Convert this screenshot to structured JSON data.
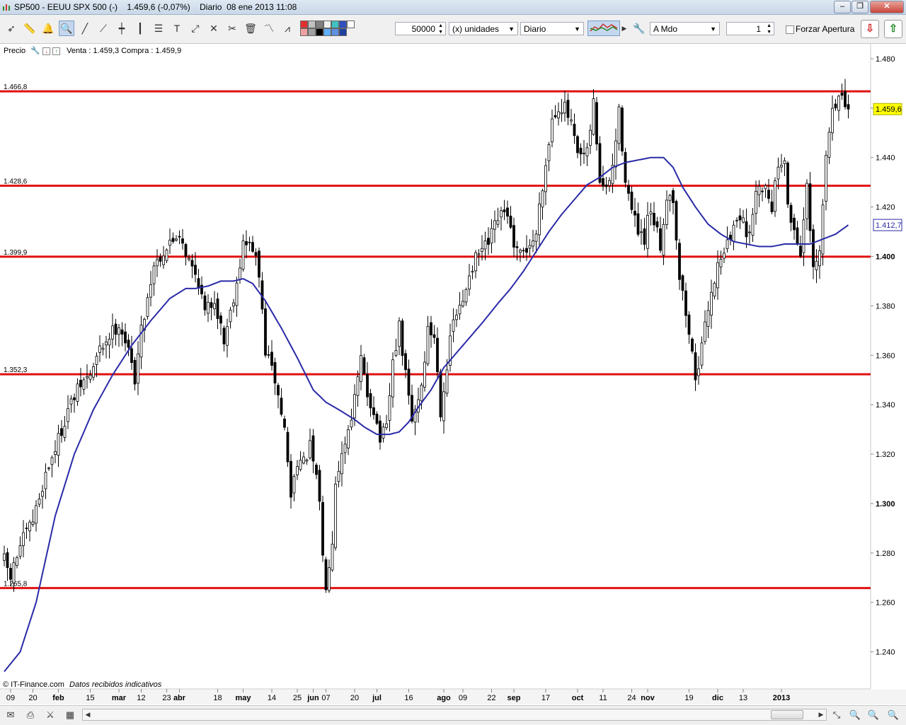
{
  "window": {
    "title": "SP500 - EEUU SPX 500 (-)    1.459,6 (-0,07%)    Diario  08 ene 2013 11:08",
    "minimize": "‒",
    "restore": "❐",
    "close": "✕"
  },
  "toolbar": {
    "quantity": "50000",
    "units": "(x) unidades",
    "period": "Diario",
    "order_type": "A Mdo",
    "lots": "1",
    "force_open": "Forzar Apertura",
    "swatch_colors": [
      "#e03030",
      "#f0a0a0",
      "#c0c0c0",
      "#a0a0a0",
      "#808080",
      "#000000",
      "#f0f0f0",
      "#60b0ff",
      "#40c0c0",
      "#6090e0",
      "#3050c0",
      "#2040a0",
      "#ffffff"
    ]
  },
  "price_panel": {
    "label": "Precio",
    "quote": "Venta : 1.459,3  Compra : 1.459,9"
  },
  "footer": {
    "source": "© IT-Finance.com",
    "note": "Datos recibidos indicativos"
  },
  "chart_data": {
    "type": "candlestick",
    "instrument": "SP500 - EEUU SPX 500",
    "period": "Diario",
    "ylim": [
      1225,
      1486
    ],
    "y_ticks": [
      1240,
      1260,
      1280,
      1300,
      1320,
      1340,
      1360,
      1380,
      1400,
      1420,
      1440,
      1460,
      1480
    ],
    "y_tick_labels": [
      "1.240",
      "1.260",
      "1.280",
      "1.300",
      "1.320",
      "1.340",
      "1.360",
      "1.380",
      "1.400",
      "1.420",
      "1.440",
      "1.460",
      "1.480"
    ],
    "y_bold_labels": [
      "1.300",
      "1.400"
    ],
    "last_price_label": "1.459,6",
    "last_price": 1459.6,
    "ma_label": "1.412,7",
    "ma_value": 1412.7,
    "x_labels": [
      {
        "t": "09",
        "i": 2
      },
      {
        "t": "20",
        "i": 9
      },
      {
        "t": "feb",
        "i": 17,
        "bold": true
      },
      {
        "t": "15",
        "i": 27
      },
      {
        "t": "mar",
        "i": 36,
        "bold": true
      },
      {
        "t": "12",
        "i": 43
      },
      {
        "t": "23",
        "i": 51
      },
      {
        "t": "abr",
        "i": 55,
        "bold": true
      },
      {
        "t": "18",
        "i": 67
      },
      {
        "t": "may",
        "i": 75,
        "bold": true
      },
      {
        "t": "14",
        "i": 84
      },
      {
        "t": "25",
        "i": 92
      },
      {
        "t": "jun",
        "i": 97,
        "bold": true
      },
      {
        "t": "07",
        "i": 101
      },
      {
        "t": "20",
        "i": 110
      },
      {
        "t": "jul",
        "i": 117,
        "bold": true
      },
      {
        "t": "16",
        "i": 127
      },
      {
        "t": "ago",
        "i": 138,
        "bold": true
      },
      {
        "t": "09",
        "i": 144
      },
      {
        "t": "22",
        "i": 153
      },
      {
        "t": "sep",
        "i": 160,
        "bold": true
      },
      {
        "t": "17",
        "i": 170
      },
      {
        "t": "oct",
        "i": 180,
        "bold": true
      },
      {
        "t": "11",
        "i": 188
      },
      {
        "t": "24",
        "i": 197
      },
      {
        "t": "nov",
        "i": 202,
        "bold": true
      },
      {
        "t": "19",
        "i": 215
      },
      {
        "t": "dic",
        "i": 224,
        "bold": true
      },
      {
        "t": "13",
        "i": 232
      },
      {
        "t": "2013",
        "i": 244,
        "bold": true
      }
    ],
    "n_bars": 251,
    "support_resistance": [
      {
        "label": "1.466,8",
        "value": 1466.8
      },
      {
        "label": "1.428,6",
        "value": 1428.6
      },
      {
        "label": "1.399,9",
        "value": 1399.9
      },
      {
        "label": "1.352,3",
        "value": 1352.3
      },
      {
        "label": "1.265,8",
        "value": 1265.8
      }
    ],
    "close_anchors": [
      [
        0,
        1277
      ],
      [
        2,
        1270
      ],
      [
        5,
        1283
      ],
      [
        9,
        1293
      ],
      [
        13,
        1312
      ],
      [
        17,
        1326
      ],
      [
        20,
        1338
      ],
      [
        24,
        1348
      ],
      [
        27,
        1352
      ],
      [
        30,
        1362
      ],
      [
        33,
        1368
      ],
      [
        36,
        1373
      ],
      [
        38,
        1366
      ],
      [
        41,
        1351
      ],
      [
        43,
        1370
      ],
      [
        47,
        1397
      ],
      [
        52,
        1405
      ],
      [
        55,
        1410
      ],
      [
        58,
        1398
      ],
      [
        61,
        1390
      ],
      [
        63,
        1377
      ],
      [
        66,
        1383
      ],
      [
        69,
        1366
      ],
      [
        73,
        1390
      ],
      [
        75,
        1405
      ],
      [
        78,
        1404
      ],
      [
        80,
        1392
      ],
      [
        82,
        1362
      ],
      [
        85,
        1350
      ],
      [
        88,
        1330
      ],
      [
        90,
        1303
      ],
      [
        92,
        1318
      ],
      [
        94,
        1316
      ],
      [
        96,
        1323
      ],
      [
        99,
        1302
      ],
      [
        100,
        1278
      ],
      [
        101,
        1268
      ],
      [
        103,
        1286
      ],
      [
        104,
        1310
      ],
      [
        107,
        1325
      ],
      [
        110,
        1342
      ],
      [
        112,
        1358
      ],
      [
        114,
        1344
      ],
      [
        116,
        1338
      ],
      [
        118,
        1326
      ],
      [
        120,
        1330
      ],
      [
        122,
        1357
      ],
      [
        124,
        1371
      ],
      [
        126,
        1352
      ],
      [
        128,
        1333
      ],
      [
        131,
        1348
      ],
      [
        133,
        1370
      ],
      [
        135,
        1368
      ],
      [
        137,
        1338
      ],
      [
        139,
        1356
      ],
      [
        141,
        1374
      ],
      [
        144,
        1381
      ],
      [
        146,
        1394
      ],
      [
        149,
        1401
      ],
      [
        152,
        1405
      ],
      [
        155,
        1415
      ],
      [
        158,
        1418
      ],
      [
        160,
        1402
      ],
      [
        162,
        1400
      ],
      [
        165,
        1405
      ],
      [
        167,
        1408
      ],
      [
        168,
        1422
      ],
      [
        170,
        1437
      ],
      [
        172,
        1456
      ],
      [
        174,
        1461
      ],
      [
        176,
        1460
      ],
      [
        178,
        1453
      ],
      [
        180,
        1440
      ],
      [
        183,
        1441
      ],
      [
        185,
        1462
      ],
      [
        187,
        1431
      ],
      [
        189,
        1426
      ],
      [
        191,
        1436
      ],
      [
        193,
        1458
      ],
      [
        195,
        1432
      ],
      [
        197,
        1418
      ],
      [
        199,
        1410
      ],
      [
        201,
        1404
      ],
      [
        202,
        1416
      ],
      [
        204,
        1414
      ],
      [
        206,
        1404
      ],
      [
        208,
        1425
      ],
      [
        210,
        1424
      ],
      [
        212,
        1392
      ],
      [
        214,
        1377
      ],
      [
        216,
        1360
      ],
      [
        217,
        1352
      ],
      [
        219,
        1362
      ],
      [
        221,
        1380
      ],
      [
        223,
        1391
      ],
      [
        225,
        1401
      ],
      [
        227,
        1405
      ],
      [
        228,
        1407
      ],
      [
        230,
        1416
      ],
      [
        232,
        1418
      ],
      [
        233,
        1405
      ],
      [
        235,
        1418
      ],
      [
        237,
        1430
      ],
      [
        239,
        1428
      ],
      [
        241,
        1421
      ],
      [
        243,
        1437
      ],
      [
        245,
        1441
      ],
      [
        246,
        1419
      ],
      [
        248,
        1411
      ],
      [
        250,
        1402
      ],
      [
        252,
        1427
      ],
      [
        254,
        1393
      ],
      [
        256,
        1401
      ],
      [
        258,
        1440
      ],
      [
        260,
        1461
      ],
      [
        262,
        1464
      ],
      [
        264,
        1461
      ],
      [
        265,
        1459.6
      ]
    ],
    "ma_anchors": [
      [
        0,
        1232
      ],
      [
        5,
        1240
      ],
      [
        10,
        1260
      ],
      [
        16,
        1295
      ],
      [
        22,
        1320
      ],
      [
        28,
        1338
      ],
      [
        34,
        1352
      ],
      [
        40,
        1364
      ],
      [
        46,
        1374
      ],
      [
        52,
        1383
      ],
      [
        57,
        1387
      ],
      [
        60,
        1387
      ],
      [
        64,
        1388
      ],
      [
        68,
        1390
      ],
      [
        72,
        1390
      ],
      [
        75,
        1391
      ],
      [
        78,
        1389
      ],
      [
        82,
        1382
      ],
      [
        87,
        1371
      ],
      [
        92,
        1359
      ],
      [
        97,
        1346
      ],
      [
        101,
        1341
      ],
      [
        105,
        1338
      ],
      [
        110,
        1334
      ],
      [
        113,
        1331
      ],
      [
        117,
        1328
      ],
      [
        121,
        1328
      ],
      [
        124,
        1329
      ],
      [
        127,
        1333
      ],
      [
        130,
        1339
      ],
      [
        134,
        1346
      ],
      [
        138,
        1355
      ],
      [
        142,
        1361
      ],
      [
        146,
        1367
      ],
      [
        150,
        1373
      ],
      [
        155,
        1381
      ],
      [
        159,
        1387
      ],
      [
        163,
        1394
      ],
      [
        167,
        1402
      ],
      [
        171,
        1410
      ],
      [
        175,
        1417
      ],
      [
        179,
        1423
      ],
      [
        183,
        1429
      ],
      [
        187,
        1432
      ],
      [
        191,
        1436
      ],
      [
        195,
        1438
      ],
      [
        199,
        1439
      ],
      [
        203,
        1440
      ],
      [
        207,
        1440
      ],
      [
        210,
        1436
      ],
      [
        213,
        1428
      ],
      [
        217,
        1420
      ],
      [
        221,
        1413
      ],
      [
        225,
        1409
      ],
      [
        229,
        1406
      ],
      [
        233,
        1405
      ],
      [
        237,
        1404
      ],
      [
        241,
        1404
      ],
      [
        245,
        1405
      ],
      [
        249,
        1405
      ],
      [
        253,
        1405
      ],
      [
        257,
        1407
      ],
      [
        261,
        1409
      ],
      [
        265,
        1412.7
      ]
    ]
  }
}
